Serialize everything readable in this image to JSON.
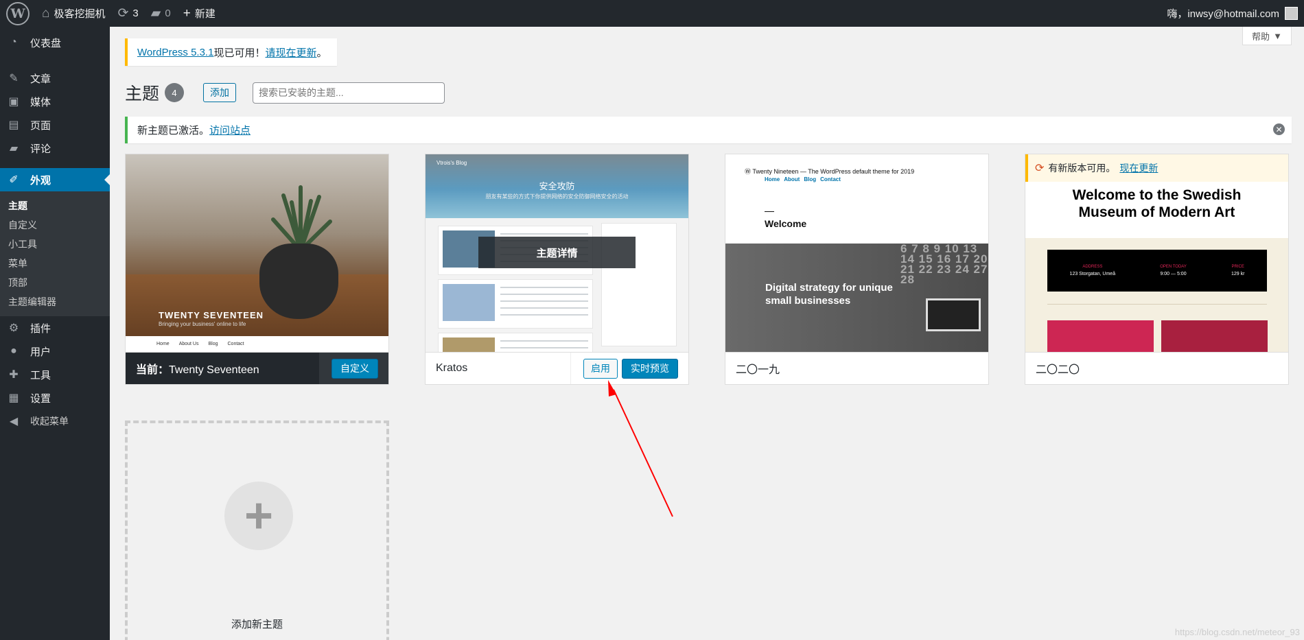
{
  "adminbar": {
    "site_name": "极客挖掘机",
    "updates_count": "3",
    "comments_count": "0",
    "new_label": "新建",
    "greeting": "嗨，inwsy@hotmail.com"
  },
  "sidebar": {
    "items": [
      {
        "label": "仪表盘",
        "icon": "dashboard-icon"
      },
      {
        "label": "文章",
        "icon": "pin-icon"
      },
      {
        "label": "媒体",
        "icon": "media-icon"
      },
      {
        "label": "页面",
        "icon": "page-icon"
      },
      {
        "label": "评论",
        "icon": "comment-icon"
      },
      {
        "label": "外观",
        "icon": "brush-icon"
      },
      {
        "label": "插件",
        "icon": "plugin-icon"
      },
      {
        "label": "用户",
        "icon": "user-icon"
      },
      {
        "label": "工具",
        "icon": "wrench-icon"
      },
      {
        "label": "设置",
        "icon": "settings-icon"
      },
      {
        "label": "收起菜单",
        "icon": "collapse-icon"
      }
    ],
    "submenu": [
      "主题",
      "自定义",
      "小工具",
      "菜单",
      "顶部",
      "主题编辑器"
    ]
  },
  "help_tab": {
    "label": "帮助"
  },
  "update_nag": {
    "version_link": "WordPress 5.3.1",
    "available": "现已可用！",
    "update_link": "请现在更新",
    "period": "。"
  },
  "page": {
    "title": "主题",
    "count": "4",
    "add_label": "添加",
    "search_placeholder": "搜索已安装的主题..."
  },
  "notice": {
    "text": "新主题已激活。",
    "link": "访问站点"
  },
  "themes": [
    {
      "active_prefix": "当前：",
      "name": "Twenty Seventeen",
      "button": "自定义",
      "shot_title": "TWENTY SEVENTEEN",
      "shot_sub": "Bringing your business' online to life",
      "shot_nav": [
        "Home",
        "About Us",
        "Blog",
        "Contact"
      ]
    },
    {
      "name": "Kratos",
      "activate": "启用",
      "preview": "实时预览",
      "overlay": "主题详情",
      "shot_brand": "Vtrois's Blog",
      "shot_title": "安全攻防",
      "shot_sub": "朋友有某些的方式下你提供网络的安全防御网络安全的活动"
    },
    {
      "name": "二〇一九",
      "shot_head": "Twenty Nineteen — The WordPress default theme for 2019",
      "shot_nav": [
        "Home",
        "About",
        "Blog",
        "Contact"
      ],
      "shot_welcome": "Welcome",
      "shot_tagline": "Digital strategy for unique small businesses",
      "shot_calendar": "6 7 8 9 10 13 14 15 16 17 20 21 22 23 24 27 28"
    },
    {
      "name": "二〇二〇",
      "update_text": "有新版本可用。",
      "update_link": "现在更新",
      "shot_title": "Welcome to the Swedish Museum of Modern Art",
      "shot_cols": [
        {
          "head": "ADDRESS",
          "val": "123 Storgatan, Umeå"
        },
        {
          "head": "OPEN TODAY",
          "val": "9:00 — 5:00"
        },
        {
          "head": "PRICE",
          "val": "129 kr"
        }
      ]
    }
  ],
  "add_new": {
    "label": "添加新主题"
  },
  "watermark": "https://blog.csdn.net/meteor_93",
  "colors": {
    "accent": "#0073aa",
    "sidebar_bg": "#23282d",
    "annotation_arrow": "#ff0000"
  }
}
